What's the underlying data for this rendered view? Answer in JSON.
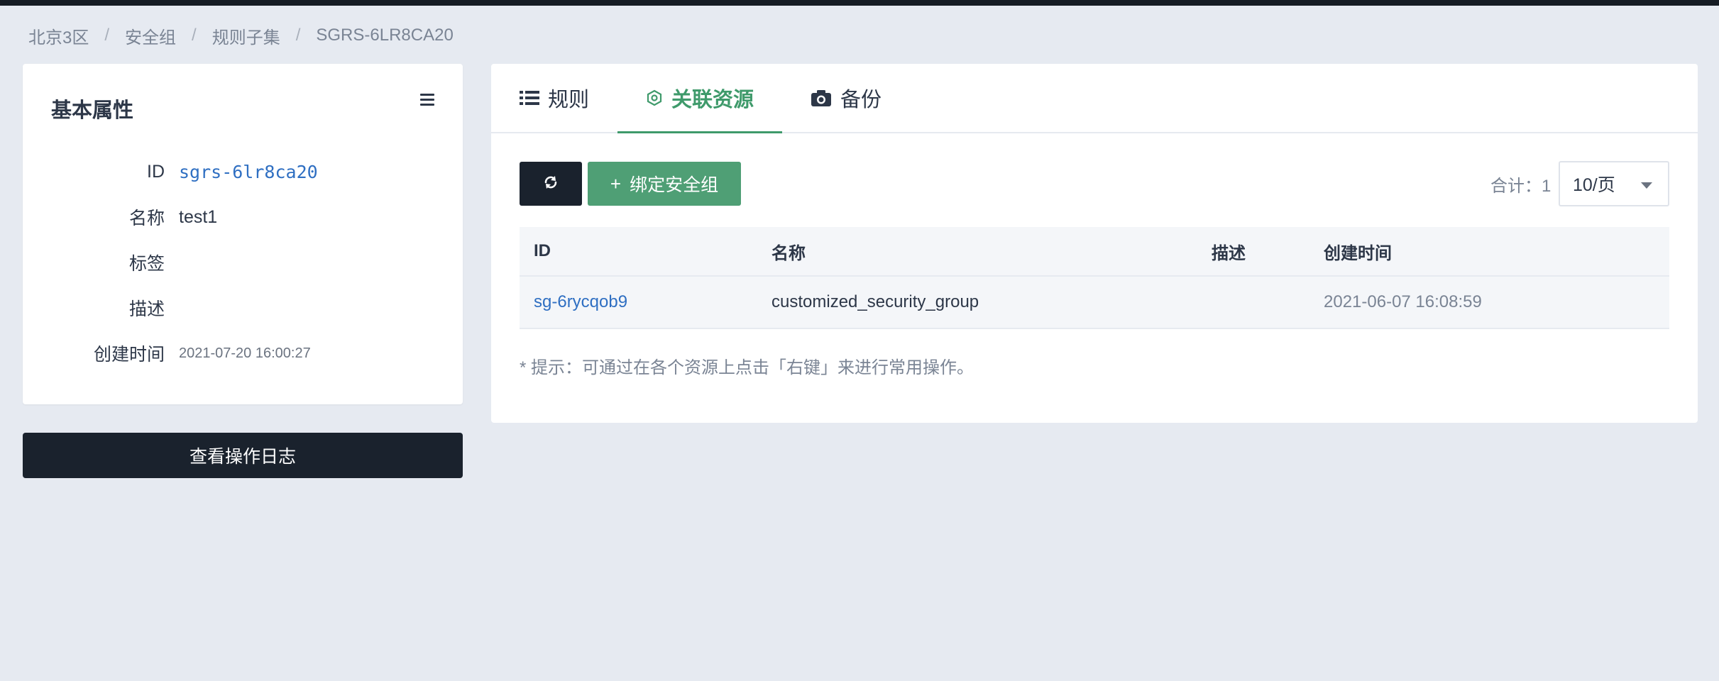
{
  "breadcrumb": [
    "北京3区",
    "安全组",
    "规则子集",
    "SGRS-6LR8CA20"
  ],
  "left_panel": {
    "title": "基本属性",
    "menu_icon": "hamburger-menu-icon",
    "properties": [
      {
        "label": "ID",
        "value": "sgrs-6lr8ca20"
      },
      {
        "label": "名称",
        "value": "test1"
      },
      {
        "label": "标签",
        "value": ""
      },
      {
        "label": "描述",
        "value": ""
      },
      {
        "label": "创建时间",
        "value": "2021-07-20 16:00:27"
      }
    ],
    "log_button": "查看操作日志"
  },
  "tabs": [
    {
      "label": "规则",
      "icon": "list-icon",
      "active": false
    },
    {
      "label": "关联资源",
      "icon": "hexagon-gear-icon",
      "active": true
    },
    {
      "label": "备份",
      "icon": "camera-icon",
      "active": false
    }
  ],
  "toolbar": {
    "refresh_icon": "refresh-icon",
    "bind_label": "绑定安全组",
    "total_label": "合计：1",
    "page_size": "10/页"
  },
  "table": {
    "headers": [
      "ID",
      "名称",
      "描述",
      "创建时间"
    ],
    "rows": [
      [
        "sg-6rycqob9",
        "customized_security_group",
        "",
        "2021-06-07 16:08:59"
      ]
    ]
  },
  "hint": "* 提示：可通过在各个资源上点击「右键」来进行常用操作。",
  "colors": {
    "accent_green": "#4f9f75",
    "dark": "#1a222d",
    "link_blue": "#2f6fc2"
  }
}
